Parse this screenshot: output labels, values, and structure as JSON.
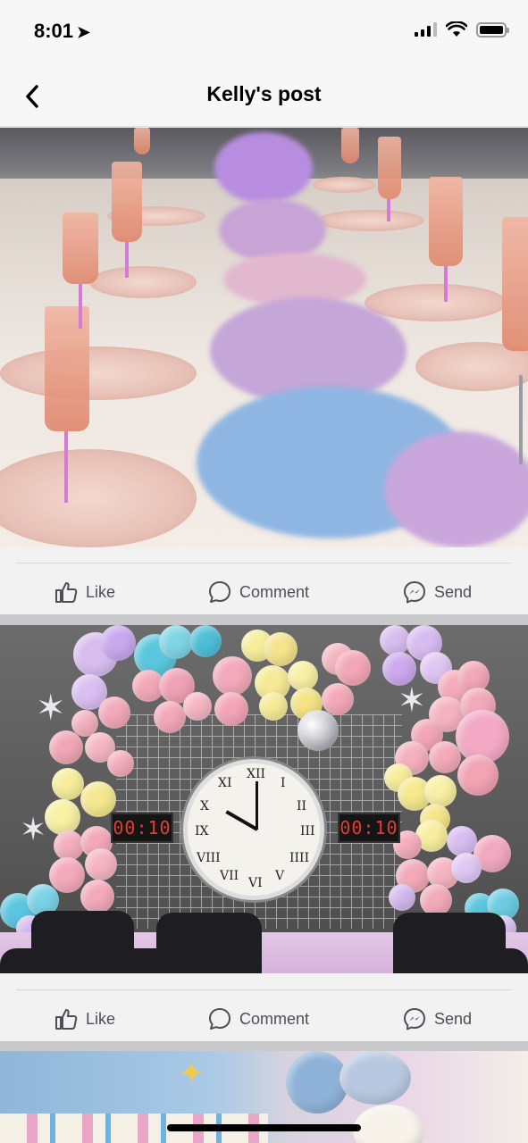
{
  "status_bar": {
    "time": "8:01",
    "icons": [
      "location-arrow-icon",
      "signal-icon",
      "wifi-icon",
      "battery-icon"
    ]
  },
  "header": {
    "title": "Kelly's post",
    "back_icon": "chevron-left-icon"
  },
  "posts": [
    {
      "actions": {
        "like": "Like",
        "comment": "Comment",
        "send": "Send"
      }
    },
    {
      "clock_timer_left": "00:10",
      "clock_timer_right": "00:10",
      "clock_numerals": [
        "XII",
        "I",
        "II",
        "III",
        "IIII",
        "V",
        "VI",
        "VII",
        "VIII",
        "IX",
        "X",
        "XI"
      ],
      "actions": {
        "like": "Like",
        "comment": "Comment",
        "send": "Send"
      }
    }
  ],
  "colors": {
    "accent_text": "#4b4f56",
    "timer_red": "#e63b2e",
    "background": "#f2f2f2"
  }
}
